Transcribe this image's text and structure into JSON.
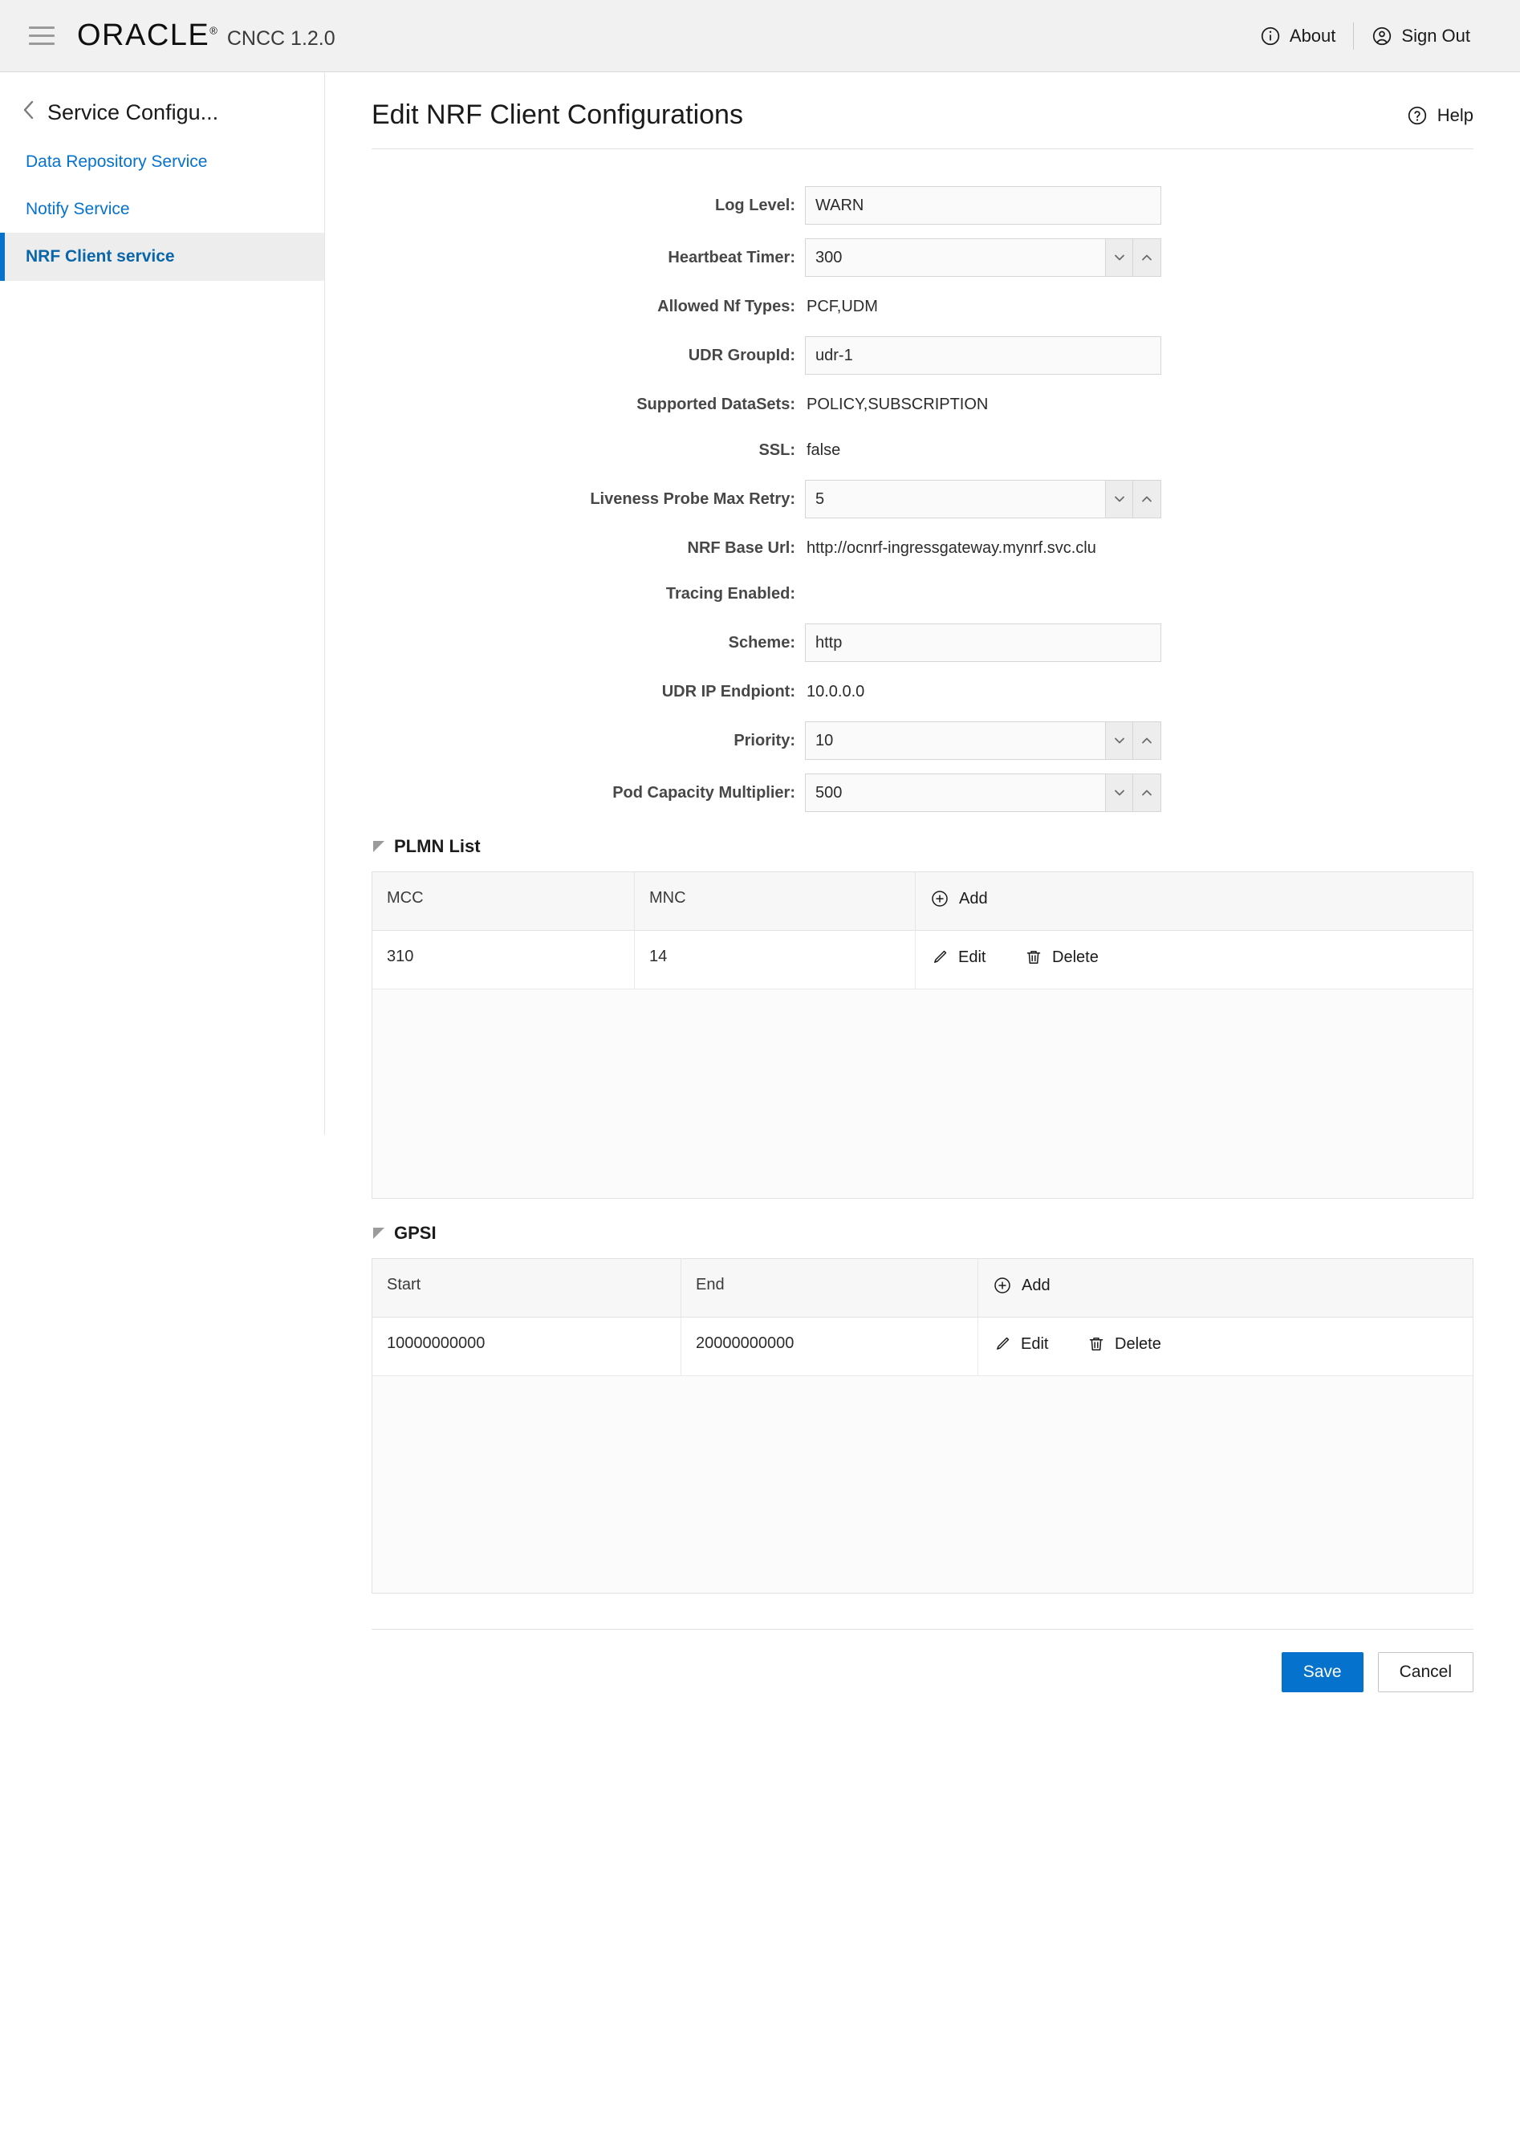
{
  "header": {
    "menu_icon": "hamburger-icon",
    "brand": "ORACLE",
    "brand_reg": "®",
    "app_version": "CNCC 1.2.0",
    "about_label": "About",
    "about_icon": "info-circle-icon",
    "signout_label": "Sign Out",
    "signout_icon": "user-circle-icon"
  },
  "sidebar": {
    "back_label": "Service Configu...",
    "back_icon": "chevron-left-icon",
    "items": [
      {
        "label": "Data Repository Service",
        "active": false
      },
      {
        "label": "Notify Service",
        "active": false
      },
      {
        "label": "NRF Client service",
        "active": true
      }
    ]
  },
  "main": {
    "title": "Edit NRF Client Configurations",
    "help_label": "Help",
    "help_icon": "question-circle-icon"
  },
  "form": {
    "fields": [
      {
        "label": "Log Level:",
        "value": "WARN",
        "type": "text"
      },
      {
        "label": "Heartbeat Timer:",
        "value": "300",
        "type": "spinner"
      },
      {
        "label": "Allowed Nf Types:",
        "value": "PCF,UDM",
        "type": "static"
      },
      {
        "label": "UDR GroupId:",
        "value": "udr-1",
        "type": "text"
      },
      {
        "label": "Supported DataSets:",
        "value": "POLICY,SUBSCRIPTION",
        "type": "static"
      },
      {
        "label": "SSL:",
        "value": "false",
        "type": "static"
      },
      {
        "label": "Liveness Probe Max Retry:",
        "value": "5",
        "type": "spinner"
      },
      {
        "label": "NRF Base Url:",
        "value": "http://ocnrf-ingressgateway.mynrf.svc.clu",
        "type": "static"
      },
      {
        "label": "Tracing Enabled:",
        "value": "",
        "type": "static"
      },
      {
        "label": "Scheme:",
        "value": "http",
        "type": "text"
      },
      {
        "label": "UDR IP Endpiont:",
        "value": "10.0.0.0",
        "type": "static"
      },
      {
        "label": "Priority:",
        "value": "10",
        "type": "spinner"
      },
      {
        "label": "Pod Capacity Multiplier:",
        "value": "500",
        "type": "spinner"
      }
    ],
    "spinner_down_icon": "chevron-down-icon",
    "spinner_up_icon": "chevron-up-icon"
  },
  "plmn_section": {
    "title": "PLMN List",
    "collapse_icon": "triangle-collapse-icon",
    "columns": [
      "MCC",
      "MNC"
    ],
    "add_label": "Add",
    "add_icon": "plus-circle-icon",
    "edit_label": "Edit",
    "edit_icon": "pencil-icon",
    "delete_label": "Delete",
    "delete_icon": "trash-icon",
    "rows": [
      {
        "mcc": "310",
        "mnc": "14"
      }
    ]
  },
  "gpsi_section": {
    "title": "GPSI",
    "collapse_icon": "triangle-collapse-icon",
    "columns": [
      "Start",
      "End"
    ],
    "add_label": "Add",
    "add_icon": "plus-circle-icon",
    "edit_label": "Edit",
    "edit_icon": "pencil-icon",
    "delete_label": "Delete",
    "delete_icon": "trash-icon",
    "rows": [
      {
        "start": "10000000000",
        "end": "20000000000"
      }
    ]
  },
  "footer": {
    "save_label": "Save",
    "cancel_label": "Cancel",
    "note": "",
    "primary_color": "#0572ce"
  }
}
